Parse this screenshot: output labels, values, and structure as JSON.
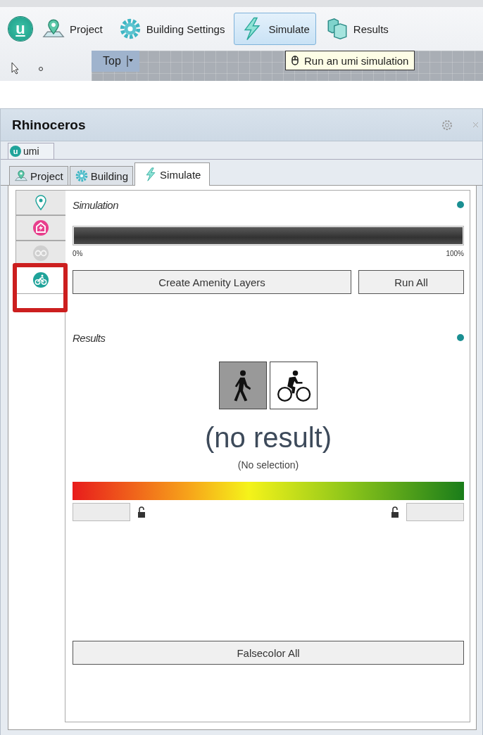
{
  "toolbar": {
    "items": [
      {
        "kind": "logo",
        "label": "u",
        "selected": false
      },
      {
        "kind": "project",
        "label": "Project",
        "selected": false
      },
      {
        "kind": "building",
        "label": "Building Settings",
        "selected": false
      },
      {
        "kind": "simulate",
        "label": "Simulate",
        "selected": true
      },
      {
        "kind": "results",
        "label": "Results",
        "selected": false
      }
    ]
  },
  "viewport": {
    "label": "Top"
  },
  "tooltip": {
    "text": "Run an umi simulation"
  },
  "panel": {
    "title": "Rhinoceros",
    "top_tab": {
      "logo": "u",
      "label": "umi"
    },
    "tabs": [
      {
        "kind": "project",
        "label": "Project",
        "selected": false
      },
      {
        "kind": "building",
        "label": "Building",
        "selected": false
      },
      {
        "kind": "simulate",
        "label": "Simulate",
        "selected": true
      }
    ],
    "sidebar": {
      "items": [
        {
          "kind": "pin",
          "selected": false,
          "disabled": false
        },
        {
          "kind": "energy",
          "selected": false,
          "disabled": false
        },
        {
          "kind": "cycle",
          "selected": false,
          "disabled": true
        },
        {
          "kind": "bike",
          "selected": true,
          "disabled": false
        }
      ],
      "highlighted": true
    },
    "simulation": {
      "title": "Simulation",
      "progress": {
        "level": 1
      },
      "min_label": "0%",
      "max_label": "100%",
      "buttons": [
        "Create Amenity Layers",
        "Run All"
      ]
    },
    "results": {
      "title": "Results",
      "modes": [
        {
          "kind": "walk",
          "selected": true
        },
        {
          "kind": "bike",
          "selected": false
        }
      ],
      "headline": "(no result)",
      "subline": "(No selection)",
      "legend": {
        "min_locked": false,
        "max_locked": false
      },
      "button": "Falsecolor All"
    }
  }
}
